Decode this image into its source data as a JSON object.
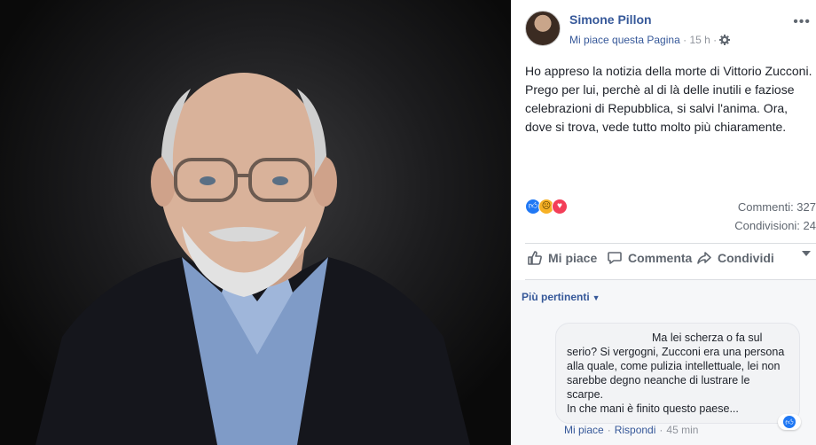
{
  "post": {
    "author": "Simone Pillon",
    "like_page": "Mi piace questa Pagina",
    "separator": "·",
    "time": "15 h",
    "more": "•••",
    "text": "Ho appreso la notizia della morte di Vittorio Zucconi. Prego per lui, perchè al di là delle inutili e faziose celebrazioni di Repubblica, si salvi l'anima. Ora, dove si trova, vede tutto molto più chiaramente.",
    "comments_count": "Commenti: 327",
    "shares_count": "Condivisioni: 24",
    "actions": {
      "like": "Mi piace",
      "comment": "Commenta",
      "share": "Condividi"
    }
  },
  "comments": {
    "sort_label": "Più pertinenti",
    "items": [
      {
        "first_line": "Ma lei scherza o fa sul",
        "rest": "serio? Si vergogni, Zucconi era una persona alla quale, come pulizia intellettuale, lei non sarebbe degno neanche di lustrare le scarpe.\nIn che mani è finito questo paese...",
        "like_label": "Mi piace",
        "reply_label": "Rispondi",
        "time": "45 min"
      }
    ]
  },
  "icons": [
    "photo",
    "avatar",
    "gear-icon",
    "more-icon",
    "like-reaction",
    "sad-reaction",
    "love-reaction",
    "thumbs-up-icon",
    "comment-icon",
    "share-icon",
    "dropdown-caret-icon"
  ],
  "colors": {
    "link": "#365899",
    "like_blue": "#2078f4",
    "text": "#1d2129",
    "muted": "#606770",
    "photo_bg": "#1c1c1e"
  }
}
